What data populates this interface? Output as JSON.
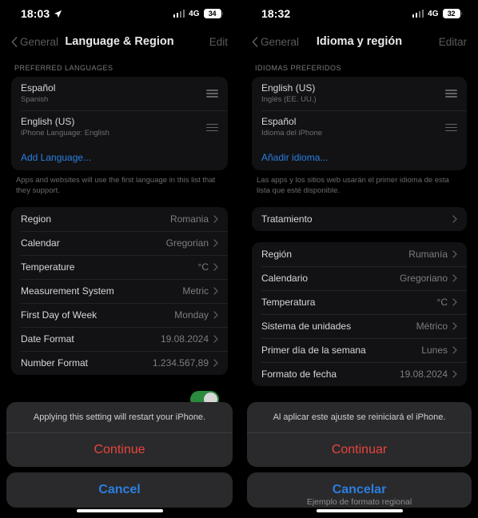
{
  "left": {
    "status": {
      "time": "18:03",
      "location_icon": "location-arrow-icon",
      "network": "4G",
      "battery": "34"
    },
    "nav": {
      "back": "General",
      "title": "Language & Region",
      "edit": "Edit"
    },
    "languages": {
      "header": "PREFERRED LANGUAGES",
      "items": [
        {
          "name": "Español",
          "sub": "Spanish"
        },
        {
          "name": "English (US)",
          "sub": "iPhone Language: English"
        }
      ],
      "add": "Add Language...",
      "footnote": "Apps and websites will use the first language in this list that they support."
    },
    "settings": [
      {
        "label": "Region",
        "value": "Romania"
      },
      {
        "label": "Calendar",
        "value": "Gregorian"
      },
      {
        "label": "Temperature",
        "value": "°C"
      },
      {
        "label": "Measurement System",
        "value": "Metric"
      },
      {
        "label": "First Day of Week",
        "value": "Monday"
      },
      {
        "label": "Date Format",
        "value": "19.08.2024"
      },
      {
        "label": "Number Format",
        "value": "1.234.567,89"
      }
    ],
    "sheet": {
      "message": "Applying this setting will restart your iPhone.",
      "confirm": "Continue",
      "cancel": "Cancel"
    }
  },
  "right": {
    "status": {
      "time": "18:32",
      "network": "4G",
      "battery": "32"
    },
    "nav": {
      "back": "General",
      "title": "Idioma y región",
      "edit": "Editar"
    },
    "languages": {
      "header": "IDIOMAS PREFERIDOS",
      "items": [
        {
          "name": "English (US)",
          "sub": "Inglés (EE. UU.)"
        },
        {
          "name": "Español",
          "sub": "Idioma del iPhone"
        }
      ],
      "add": "Añadir idioma...",
      "footnote": "Las apps y los sitios web usarán el primer idioma de esta lista que esté disponible."
    },
    "treatment": {
      "label": "Tratamiento"
    },
    "settings": [
      {
        "label": "Región",
        "value": "Rumanía"
      },
      {
        "label": "Calendario",
        "value": "Gregoriano"
      },
      {
        "label": "Temperatura",
        "value": "°C"
      },
      {
        "label": "Sistema de unidades",
        "value": "Métrico"
      },
      {
        "label": "Primer día de la semana",
        "value": "Lunes"
      },
      {
        "label": "Formato de fecha",
        "value": "19.08.2024"
      }
    ],
    "sheet": {
      "message": "Al aplicar este ajuste se reiniciará el iPhone.",
      "confirm": "Continuar",
      "cancel": "Cancelar"
    },
    "regional_note": "Ejemplo de formato regional"
  },
  "colors": {
    "accent_blue": "#2b7fe0",
    "destructive_red": "#e8453c",
    "toggle_green": "#2a8a3e"
  }
}
